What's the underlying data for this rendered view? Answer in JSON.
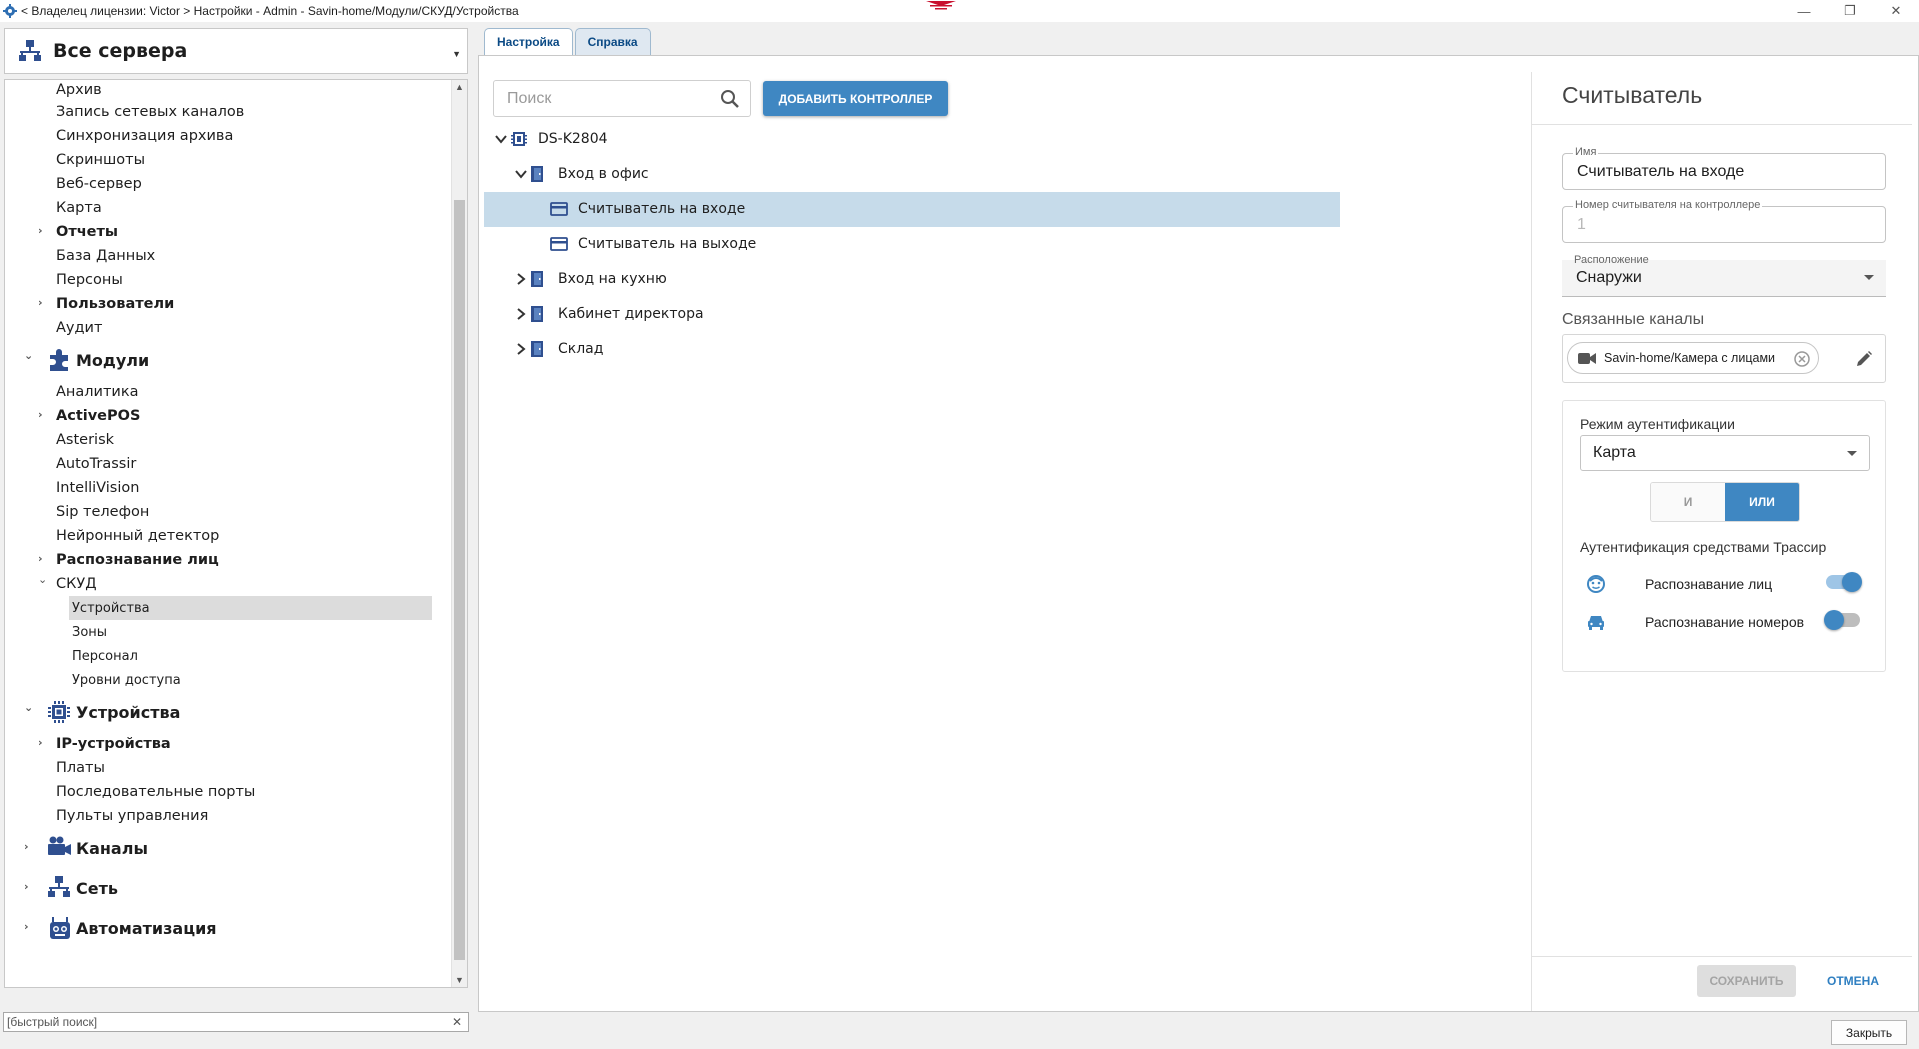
{
  "titlebar": {
    "path": "< Владелец лицензии: Victor > Настройки - Admin - Savin-home/Модули/СКУД/Устройства",
    "minimize": "—",
    "restore": "❐",
    "close": "✕"
  },
  "left": {
    "server_select": "Все сервера",
    "tree": [
      {
        "label": "Архив",
        "level": 1
      },
      {
        "label": "Запись сетевых каналов",
        "level": 1
      },
      {
        "label": "Синхронизация архива",
        "level": 1
      },
      {
        "label": "Скриншоты",
        "level": 1
      },
      {
        "label": "Веб-сервер",
        "level": 1
      },
      {
        "label": "Карта",
        "level": 1
      },
      {
        "label": "Отчеты",
        "level": 1,
        "bold": true,
        "expander": "›"
      },
      {
        "label": "База Данных",
        "level": 1
      },
      {
        "label": "Персоны",
        "level": 1
      },
      {
        "label": "Пользователи",
        "level": 1,
        "bold": true,
        "expander": "›"
      },
      {
        "label": "Аудит",
        "level": 1
      },
      {
        "label": "Модули",
        "level": 0,
        "section": true,
        "expander": "⌄",
        "icon": "puzzle-icon"
      },
      {
        "label": "Аналитика",
        "level": 1
      },
      {
        "label": "ActivePOS",
        "level": 1,
        "bold": true,
        "expander": "›"
      },
      {
        "label": "Asterisk",
        "level": 1
      },
      {
        "label": "AutoTrassir",
        "level": 1
      },
      {
        "label": "IntelliVision",
        "level": 1
      },
      {
        "label": "Sip телефон",
        "level": 1
      },
      {
        "label": "Нейронный детектор",
        "level": 1
      },
      {
        "label": "Распознавание лиц",
        "level": 1,
        "bold": true,
        "expander": "›"
      },
      {
        "label": "СКУД",
        "level": 1,
        "expander": "⌄"
      },
      {
        "label": "Устройства",
        "level": 2,
        "selected": true
      },
      {
        "label": "Зоны",
        "level": 2
      },
      {
        "label": "Персонал",
        "level": 2
      },
      {
        "label": "Уровни доступа",
        "level": 2
      },
      {
        "label": "Устройства",
        "level": 0,
        "section": true,
        "expander": "⌄",
        "icon": "chip-icon"
      },
      {
        "label": "IP-устройства",
        "level": 1,
        "bold": true,
        "expander": "›"
      },
      {
        "label": "Платы",
        "level": 1
      },
      {
        "label": "Последовательные порты",
        "level": 1
      },
      {
        "label": "Пульты управления",
        "level": 1
      },
      {
        "label": "Каналы",
        "level": 0,
        "section": true,
        "expander": "›",
        "icon": "camera-icon"
      },
      {
        "label": "Сеть",
        "level": 0,
        "section": true,
        "expander": "›",
        "icon": "network-icon"
      },
      {
        "label": "Автоматизация",
        "level": 0,
        "section": true,
        "expander": "›",
        "icon": "robot-icon"
      }
    ],
    "quick_search_placeholder": "[быстрый поиск]"
  },
  "tabs": [
    {
      "label": "Настройка",
      "active": true
    },
    {
      "label": "Справка",
      "active": false
    }
  ],
  "main": {
    "search_placeholder": "Поиск",
    "add_controller_label": "ДОБАВИТЬ КОНТРОЛЛЕР",
    "devices": [
      {
        "label": "DS-K2804",
        "depth": 0,
        "expander": "down",
        "icon": "controller-icon"
      },
      {
        "label": "Вход в офис",
        "depth": 1,
        "expander": "down",
        "icon": "door-icon"
      },
      {
        "label": "Считыватель на входе",
        "depth": 2,
        "icon": "reader-icon",
        "selected": true
      },
      {
        "label": "Считыватель на выходе",
        "depth": 2,
        "icon": "reader-icon"
      },
      {
        "label": "Вход на кухню",
        "depth": 1,
        "expander": "right",
        "icon": "door-icon"
      },
      {
        "label": "Кабинет директора",
        "depth": 1,
        "expander": "right",
        "icon": "door-icon"
      },
      {
        "label": "Склад",
        "depth": 1,
        "expander": "right",
        "icon": "door-icon"
      }
    ]
  },
  "reader_panel": {
    "title": "Считыватель",
    "name_label": "Имя",
    "name_value": "Считыватель на входе",
    "number_label": "Номер считывателя на контроллере",
    "number_value": "1",
    "location_label": "Расположение",
    "location_value": "Снаружи",
    "linked_label": "Связанные каналы",
    "linked_chip": "Savin-home/Камера с лицами",
    "auth_mode_label": "Режим аутентификации",
    "auth_mode_value": "Карта",
    "seg_and": "И",
    "seg_or": "ИЛИ",
    "trassir_label": "Аутентификация средствами Трассир",
    "face_label": "Распознавание лиц",
    "face_enabled": true,
    "plate_label": "Распознавание номеров",
    "plate_enabled": false,
    "save_label": "СОХРАНИТЬ",
    "cancel_label": "ОТМЕНА"
  },
  "footer": {
    "close_label": "Закрыть"
  },
  "colors": {
    "accent": "#3f87c2",
    "selection": "#c6dbea",
    "tab_text": "#0b4a85",
    "brand": "#c8102e"
  }
}
